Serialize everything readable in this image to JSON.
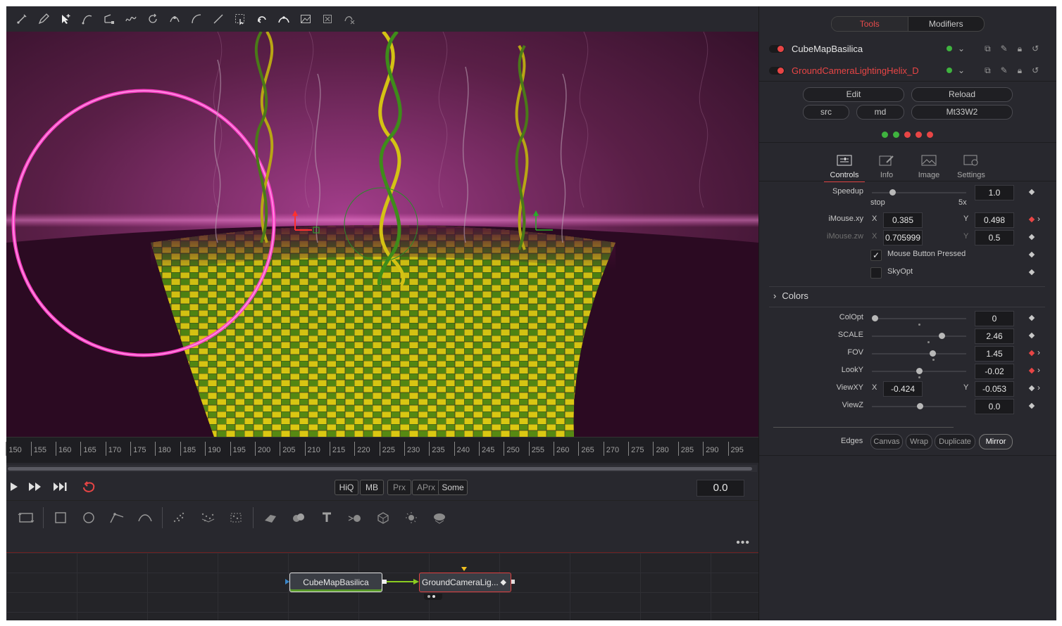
{
  "viewer": {
    "timeline_ticks": [
      "150",
      "155",
      "160",
      "165",
      "170",
      "175",
      "180",
      "185",
      "190",
      "195",
      "200",
      "205",
      "210",
      "215",
      "220",
      "225",
      "230",
      "235",
      "240",
      "245",
      "250",
      "255",
      "260",
      "265",
      "270",
      "275",
      "280",
      "285",
      "290",
      "295"
    ],
    "scrub_progress": 0.995
  },
  "transport": {
    "quality_buttons": [
      "HiQ",
      "MB",
      "Prx",
      "APrx",
      "Some"
    ],
    "current_time": "0.0"
  },
  "flow": {
    "node1": "CubeMapBasilica",
    "node2": "GroundCameraLig...",
    "menu": "•••"
  },
  "panel": {
    "tabs": {
      "tools": "Tools",
      "modifiers": "Modifiers"
    },
    "tool1": "CubeMapBasilica",
    "tool2": "GroundCameraLightingHelix_D",
    "buttons": {
      "edit": "Edit",
      "reload": "Reload",
      "src": "src",
      "md": "md",
      "mt": "Mt33W2"
    },
    "dot_colors": [
      "#3fb33f",
      "#3fb33f",
      "#e84545",
      "#e84545",
      "#e84545"
    ],
    "ctl_tabs": {
      "controls": "Controls",
      "info": "Info",
      "image": "Image",
      "settings": "Settings"
    },
    "speedup": {
      "label": "Speedup",
      "value": "1.0",
      "min_label": "stop",
      "max_label": "5x",
      "level": 0.22
    },
    "imouse_xy": {
      "label": "iMouse.xy",
      "x_label": "X",
      "x": "0.385",
      "y_label": "Y",
      "y": "0.498"
    },
    "imouse_zw": {
      "label": "iMouse.zw",
      "x_label": "X",
      "x": "0.705999",
      "y_label": "Y",
      "y": "0.5"
    },
    "mouse_pressed": {
      "label": "Mouse Button Pressed",
      "checked": "✓"
    },
    "skyopt": {
      "label": "SkyOpt"
    },
    "colors_section": "Colors",
    "colopt": {
      "label": "ColOpt",
      "value": "0",
      "level": 0.03
    },
    "scale": {
      "label": "SCALE",
      "value": "2.46",
      "level": 0.74
    },
    "fov": {
      "label": "FOV",
      "value": "1.45",
      "level": 0.64
    },
    "looky": {
      "label": "LookY",
      "value": "-0.02",
      "level": 0.5
    },
    "viewxy": {
      "label": "ViewXY",
      "x_label": "X",
      "x": "-0.424",
      "y_label": "Y",
      "y": "-0.053"
    },
    "viewz": {
      "label": "ViewZ",
      "value": "0.0",
      "level": 0.51
    },
    "edges": {
      "label": "Edges",
      "options": [
        "Canvas",
        "Wrap",
        "Duplicate",
        "Mirror"
      ],
      "selected": "Mirror"
    }
  }
}
